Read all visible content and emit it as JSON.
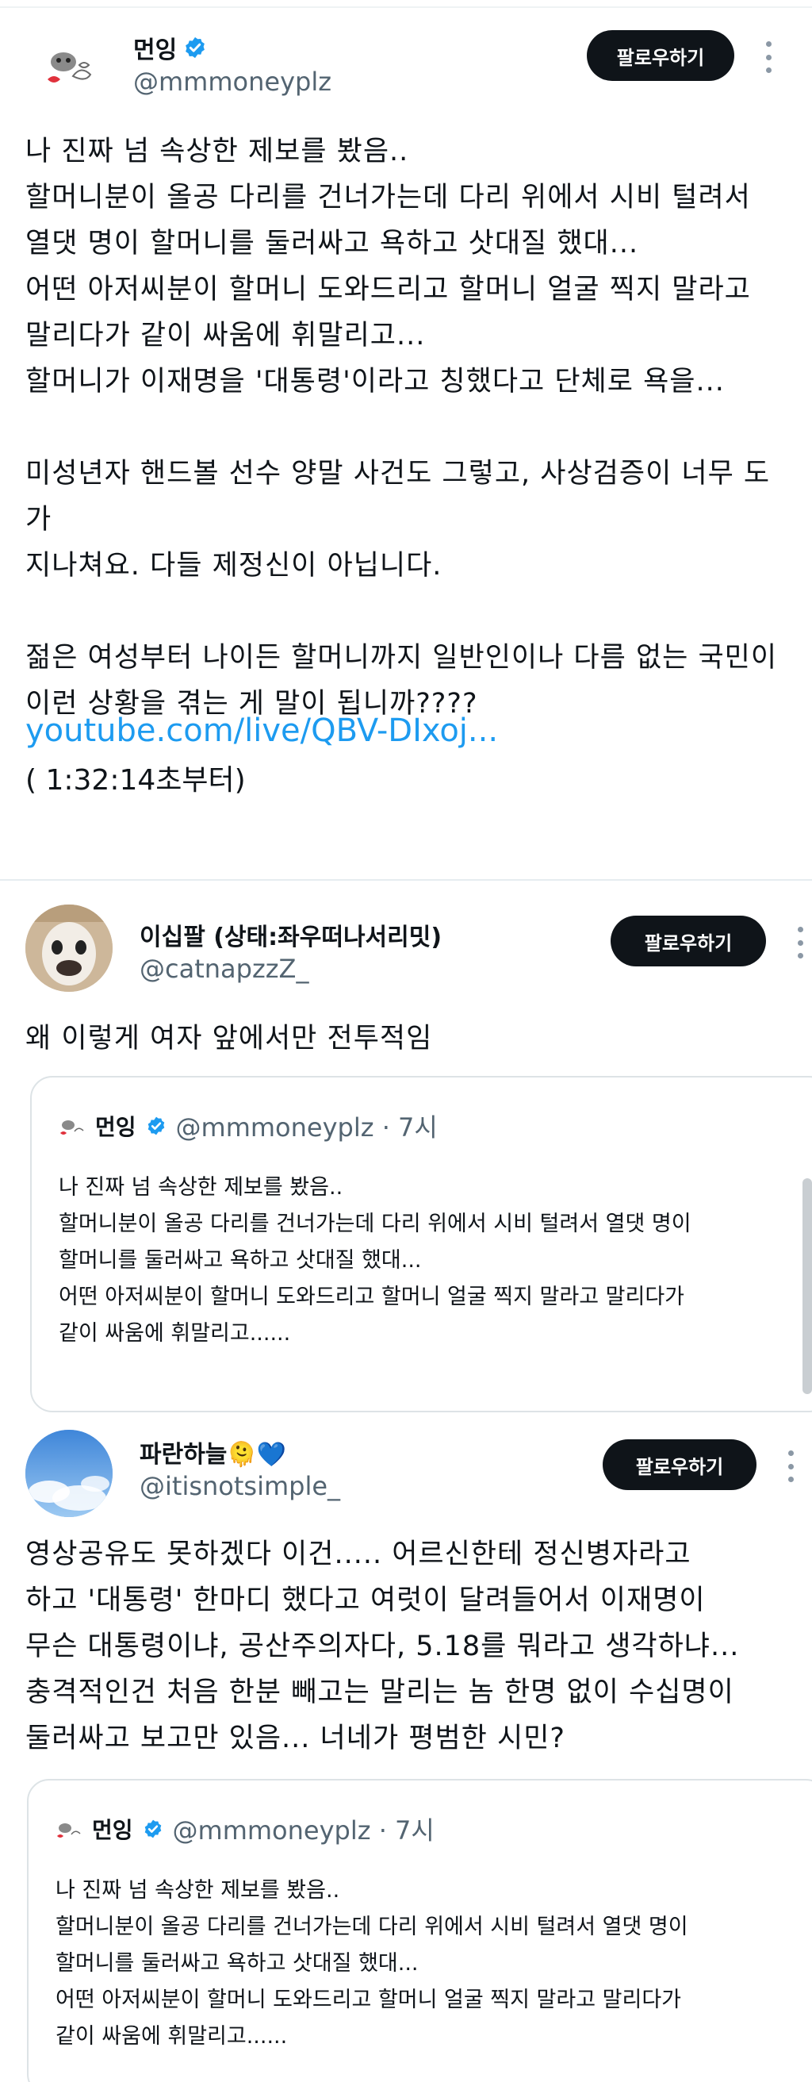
{
  "posts": [
    {
      "display_name": "먼잉",
      "handle": "@mmmoneyplz",
      "follow_label": "팔로우하기",
      "body": "나 진짜 넘 속상한 제보를 봤음..\n할머니분이 올공 다리를 건너가는데 다리 위에서 시비 털려서\n열댓 명이 할머니를 둘러싸고 욕하고 삿대질 했대...\n어떤 아저씨분이 할머니 도와드리고 할머니 얼굴 찍지 말라고\n말리다가 같이 싸움에 휘말리고...\n할머니가 이재명을 '대통령'이라고 칭했다고 단체로 욕을...\n\n미성년자 핸드볼 선수 양말 사건도 그렇고, 사상검증이 너무 도가\n지나쳐요. 다들 제정신이 아닙니다.\n\n젊은 여성부터 나이든 할머니까지 일반인이나 다름 없는 국민이\n이런 상황을 겪는 게 말이 됩니까????",
      "link": "youtube.com/live/QBV-DIxoj...",
      "timestamp": "( 1:32:14초부터)"
    },
    {
      "display_name": "이십팔 (상태:좌우떠나서리밋)",
      "handle": "@catnapzzZ_",
      "follow_label": "팔로우하기",
      "body": "왜 이렇게 여자 앞에서만 전투적임",
      "quote": {
        "name": "먼잉",
        "handle_time": "@mmmoneyplz · 7시",
        "text": "나 진짜 넘 속상한 제보를 봤음..\n할머니분이 올공 다리를 건너가는데 다리 위에서 시비 털려서 열댓 명이\n할머니를 둘러싸고 욕하고 삿대질 했대...\n어떤 아저씨분이 할머니 도와드리고 할머니 얼굴 찍지 말라고 말리다가\n같이 싸움에 휘말리고......"
      }
    },
    {
      "display_name": "파란하늘🫠💙",
      "handle": "@itisnotsimple_",
      "follow_label": "팔로우하기",
      "body": "영상공유도 못하겠다 이건..... 어르신한테 정신병자라고\n하고 '대통령' 한마디 했다고 여럿이 달려들어서 이재명이\n무슨 대통령이냐, 공산주의자다, 5.18를 뭐라고 생각하냐...\n충격적인건 처음 한분 빼고는 말리는 놈 한명 없이 수십명이\n둘러싸고 보고만 있음... 너네가 평범한 시민?",
      "quote": {
        "name": "먼잉",
        "handle_time": "@mmmoneyplz · 7시",
        "text": "나 진짜 넘 속상한 제보를 봤음..\n할머니분이 올공 다리를 건너가는데 다리 위에서 시비 털려서 열댓 명이\n할머니를 둘러싸고 욕하고 삿대질 했대...\n어떤 아저씨분이 할머니 도와드리고 할머니 얼굴 찍지 말라고 말리다가\n같이 싸움에 휘말리고......"
      }
    }
  ],
  "colors": {
    "verified": "#1d9bf0",
    "link": "#1d9bf0",
    "follow_button": "#0f1419",
    "handle": "#536471"
  },
  "icons": [
    "verified-badge-icon",
    "more-options-icon"
  ]
}
